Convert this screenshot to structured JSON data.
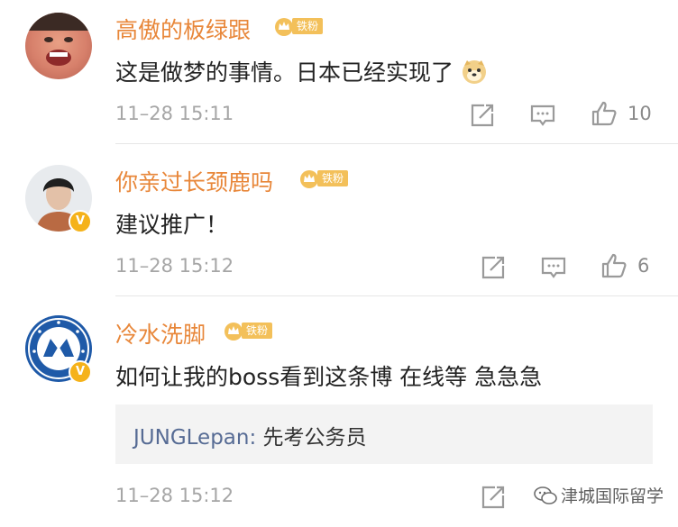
{
  "comments": [
    {
      "name": "高傲的板绿跟",
      "badge": "铁粉",
      "text": "这是做梦的事情。日本已经实现了",
      "emoji": "doge-emoji",
      "time": "11–28 15:11",
      "likes": "10"
    },
    {
      "name": "你亲过长颈鹿吗",
      "badge": "铁粉",
      "verified": "V",
      "text": "建议推广！",
      "time": "11–28 15:12",
      "likes": "6"
    },
    {
      "name": "冷水洗脚",
      "badge": "铁粉",
      "verified": "V",
      "text": "如何让我的boss看到这条博 在线等 急急急",
      "reply_user": "JUNGLepan:",
      "reply_text": " 先考公务员",
      "time": "11–28 15:12"
    }
  ],
  "watermark": "津城国际留学",
  "colors": {
    "name": "#e8873a",
    "badge": "#f3c05a",
    "icon": "#9a9a9a",
    "reply_user": "#566b94"
  }
}
